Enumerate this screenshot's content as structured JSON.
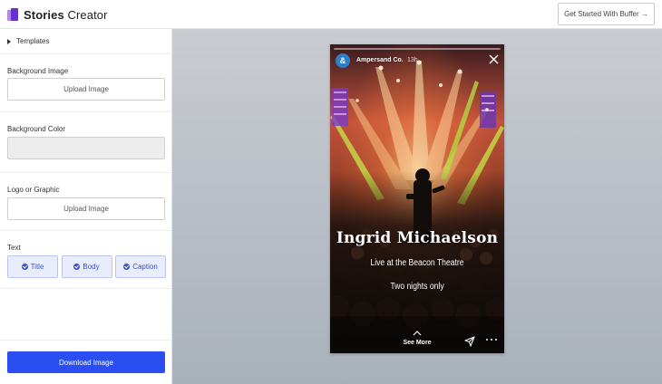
{
  "header": {
    "logo_bold": "Stories",
    "logo_rest": " Creator",
    "cta_label": "Get Started With Buffer →"
  },
  "sidebar": {
    "templates_label": "Templates",
    "background_image_label": "Background Image",
    "background_image_button": "Upload Image",
    "background_color_label": "Background Color",
    "background_color_value": "#ededed",
    "logo_label": "Logo or Graphic",
    "logo_button": "Upload Image",
    "text_label": "Text",
    "text_buttons": [
      "Title",
      "Body",
      "Caption"
    ],
    "download_label": "Download Image"
  },
  "story": {
    "avatar_glyph": "&",
    "account_name": "Ampersand Co.",
    "time": "13h",
    "title": "Ingrid Michaelson",
    "body": "Live at the Beacon Theatre",
    "caption": "Two nights only",
    "see_more": "See More"
  },
  "colors": {
    "accent": "#2b4ef2",
    "toggle_bg": "#e9edfb",
    "toggle_text": "#3753c7",
    "logo_purple": "#6a2fd0",
    "avatar_blue": "#2e7fc9"
  },
  "icons": {
    "logo": "stories-logo-icon",
    "templates": "caret-right-icon",
    "checks": "check-circle-icon",
    "close": "close-icon",
    "up": "chevron-up-icon",
    "send": "send-icon",
    "more": "more-dots-icon"
  }
}
